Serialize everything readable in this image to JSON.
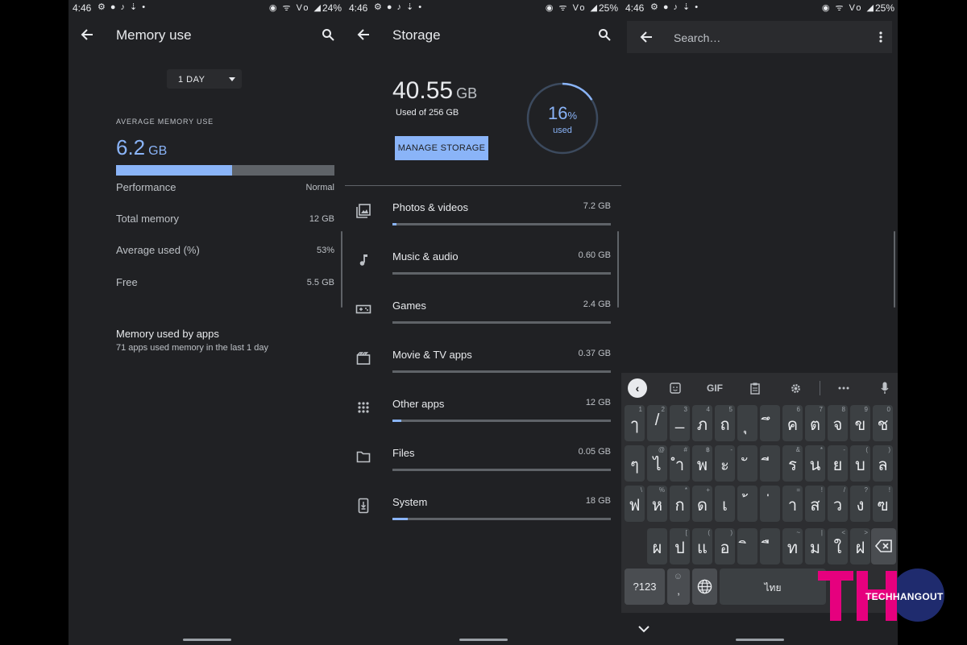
{
  "panels": [
    {
      "status": {
        "time": "4:46",
        "battery": "24%"
      },
      "title": "Memory use",
      "period": "1 DAY",
      "avg_label": "AVERAGE MEMORY USE",
      "avg_value": "6.2",
      "avg_unit": "GB",
      "avg_fraction": 0.53,
      "stats": [
        {
          "label": "Performance",
          "value": "Normal"
        },
        {
          "label": "Total memory",
          "value": "12 GB"
        },
        {
          "label": "Average used (%)",
          "value": "53%"
        },
        {
          "label": "Free",
          "value": "5.5 GB"
        }
      ],
      "apps_title": "Memory used by apps",
      "apps_subtitle": "71 apps used memory in the last 1 day"
    },
    {
      "status": {
        "time": "4:46",
        "battery": "25%"
      },
      "title": "Storage",
      "used_value": "40.55",
      "used_unit": "GB",
      "used_of": "Used of 256 GB",
      "manage_label": "MANAGE STORAGE",
      "ring_percent": "16",
      "ring_percent_sign": "%",
      "ring_label": "used",
      "ring_fraction": 0.16,
      "categories": [
        {
          "name": "Photos & videos",
          "size": "7.2 GB",
          "fraction": 0.02,
          "icon": "photo-icon"
        },
        {
          "name": "Music & audio",
          "size": "0.60 GB",
          "fraction": 0.0,
          "icon": "music-note-icon"
        },
        {
          "name": "Games",
          "size": "2.4 GB",
          "fraction": 0.0,
          "icon": "gamepad-icon"
        },
        {
          "name": "Movie & TV apps",
          "size": "0.37 GB",
          "fraction": 0.0,
          "icon": "movie-icon"
        },
        {
          "name": "Other apps",
          "size": "12 GB",
          "fraction": 0.04,
          "icon": "apps-grid-icon"
        },
        {
          "name": "Files",
          "size": "0.05 GB",
          "fraction": 0.0,
          "icon": "folder-icon"
        },
        {
          "name": "System",
          "size": "18 GB",
          "fraction": 0.07,
          "icon": "system-phone-icon"
        }
      ]
    },
    {
      "status": {
        "time": "4:46",
        "battery": "25%"
      },
      "search_placeholder": "Search…",
      "keyboard": {
        "toolbar": {
          "gif": "GIF"
        },
        "rows": [
          [
            [
              "ๅ",
              "1"
            ],
            [
              "/",
              "2"
            ],
            [
              "_",
              "3"
            ],
            [
              "ภ",
              "4"
            ],
            [
              "ถ",
              "5"
            ],
            [
              "ุ",
              ""
            ],
            [
              "ึ",
              ""
            ],
            [
              "ค",
              "6"
            ],
            [
              "ต",
              "7"
            ],
            [
              "จ",
              "8"
            ],
            [
              "ข",
              "9"
            ],
            [
              "ช",
              "0"
            ]
          ],
          [
            [
              "ๆ",
              ""
            ],
            [
              "ไ",
              "@"
            ],
            [
              "ำ",
              "#"
            ],
            [
              "พ",
              "฿"
            ],
            [
              "ะ",
              "-"
            ],
            [
              "ั",
              ""
            ],
            [
              "ี",
              ""
            ],
            [
              "ร",
              "&"
            ],
            [
              "น",
              "*"
            ],
            [
              "ย",
              "-"
            ],
            [
              "บ",
              "("
            ],
            [
              "ล",
              ")"
            ]
          ],
          [
            [
              "ฟ",
              "\\"
            ],
            [
              "ห",
              "%"
            ],
            [
              "ก",
              "*"
            ],
            [
              "ด",
              "+"
            ],
            [
              "เ",
              ""
            ],
            [
              "้",
              ""
            ],
            [
              "่",
              ""
            ],
            [
              "า",
              "="
            ],
            [
              "ส",
              "!"
            ],
            [
              "ว",
              "/"
            ],
            [
              "ง",
              "?"
            ],
            [
              "ฃ",
              "!"
            ]
          ],
          [
            [
              "ผ",
              ""
            ],
            [
              "ป",
              "["
            ],
            [
              "แ",
              "("
            ],
            [
              "อ",
              ")"
            ],
            [
              "ิ",
              ""
            ],
            [
              "ื",
              ""
            ],
            [
              "ท",
              "~"
            ],
            [
              "ม",
              "|"
            ],
            [
              "ใ",
              "<"
            ],
            [
              "ฝ",
              ">"
            ]
          ]
        ],
        "symbols_label": "?123",
        "comma_label": ",",
        "space_label": "ไทย",
        "emoji_hint": "☺"
      },
      "watermark": "TECHHANGOUT",
      "watermark_letters": "TH"
    }
  ],
  "colors": {
    "accent": "#8ab4f8",
    "background": "#202124",
    "track": "#5f6368",
    "logo_pink": "#e6007e",
    "logo_navy": "#1f2b6e"
  }
}
